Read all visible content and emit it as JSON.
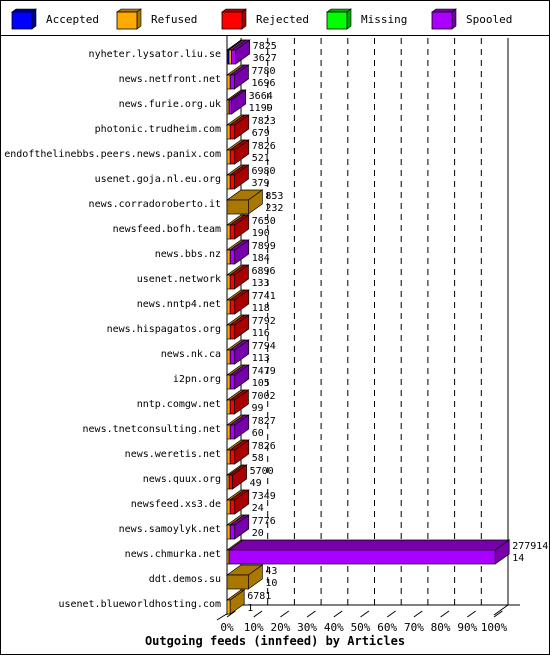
{
  "chart_data": {
    "type": "bar",
    "orientation": "horizontal",
    "stacked": true,
    "percent_scale": true,
    "title": "Outgoing feeds (innfeed) by Articles",
    "xlabel": "Outgoing feeds (innfeed) by Articles",
    "ylabel": "",
    "xlim": [
      0,
      100
    ],
    "xticks": [
      "0%",
      "10%",
      "20%",
      "30%",
      "40%",
      "50%",
      "60%",
      "70%",
      "80%",
      "90%",
      "100%"
    ],
    "grid": true,
    "legend_position": "top",
    "legend": [
      {
        "name": "Accepted",
        "color": "#0000ff",
        "side": "#000099"
      },
      {
        "name": "Refused",
        "color": "#ffaa00",
        "side": "#aa7700"
      },
      {
        "name": "Rejected",
        "color": "#ff0000",
        "side": "#aa0000"
      },
      {
        "name": "Missing",
        "color": "#00ff00",
        "side": "#00aa00"
      },
      {
        "name": "Spooled",
        "color": "#aa00ff",
        "side": "#7700aa"
      }
    ],
    "categories": [
      "nyheter.lysator.liu.se",
      "news.netfront.net",
      "news.furie.org.uk",
      "photonic.trudheim.com",
      "endofthelinebbs.peers.news.panix.com",
      "usenet.goja.nl.eu.org",
      "news.corradoroberto.it",
      "newsfeed.bofh.team",
      "news.bbs.nz",
      "usenet.network",
      "news.nntp4.net",
      "news.hispagatos.org",
      "news.nk.ca",
      "i2pn.org",
      "nntp.comgw.net",
      "news.tnetconsulting.net",
      "news.weretis.net",
      "news.quux.org",
      "newsfeed.xs3.de",
      "news.samoylyk.net",
      "news.chmurka.net",
      "ddt.demos.su",
      "usenet.blueworldhosting.com"
    ],
    "labels_top": [
      "7825",
      "7780",
      "3664",
      "7823",
      "7826",
      "6980",
      "853",
      "7650",
      "7899",
      "6896",
      "7741",
      "7792",
      "7794",
      "7479",
      "7002",
      "7827",
      "7826",
      "5700",
      "7349",
      "7776",
      "277914",
      "43",
      "6781"
    ],
    "labels_bottom": [
      "3627",
      "1696",
      "1199",
      "679",
      "521",
      "379",
      "232",
      "190",
      "184",
      "133",
      "118",
      "116",
      "113",
      "105",
      "99",
      "60",
      "58",
      "49",
      "24",
      "20",
      "14",
      "10",
      "1"
    ],
    "series": [
      {
        "name": "Accepted",
        "values": [
          0.6,
          0,
          0,
          0,
          0,
          0,
          0,
          0,
          0,
          0,
          0,
          0,
          0,
          0,
          0,
          0,
          0,
          0,
          0,
          0,
          0,
          0,
          0
        ]
      },
      {
        "name": "Refused",
        "values": [
          0.9,
          1.2,
          0.3,
          1.2,
          1.2,
          1.2,
          8,
          1.2,
          1.2,
          1.2,
          1.2,
          1.2,
          1.2,
          1.2,
          1.2,
          1.2,
          1.2,
          0.8,
          1.2,
          1.2,
          0.3,
          8,
          1.2
        ]
      },
      {
        "name": "Rejected",
        "values": [
          0,
          0,
          0,
          1.7,
          1.7,
          1.6,
          0,
          1.7,
          0,
          1.6,
          1.7,
          1.7,
          0,
          0,
          1.6,
          0,
          1.7,
          1.3,
          1.7,
          0,
          0,
          0,
          0
        ]
      },
      {
        "name": "Missing",
        "values": [
          0,
          0,
          0,
          0,
          0,
          0,
          0,
          0,
          0,
          0,
          0,
          0,
          0,
          0,
          0,
          0,
          0,
          0,
          0,
          0,
          0,
          0,
          0
        ]
      },
      {
        "name": "Spooled",
        "values": [
          1.6,
          1.6,
          1.0,
          0,
          0,
          0,
          0,
          0,
          1.7,
          0,
          0,
          0,
          1.7,
          1.7,
          0,
          1.7,
          0,
          0,
          0,
          1.7,
          99.7,
          0,
          0
        ]
      }
    ],
    "extra_segment_color": {
      "name": "other",
      "color": "#aa7700"
    },
    "notes": "Percentages estimated as fraction of max row total (277914); brown segments are shaded side-faces of Refused bars."
  }
}
